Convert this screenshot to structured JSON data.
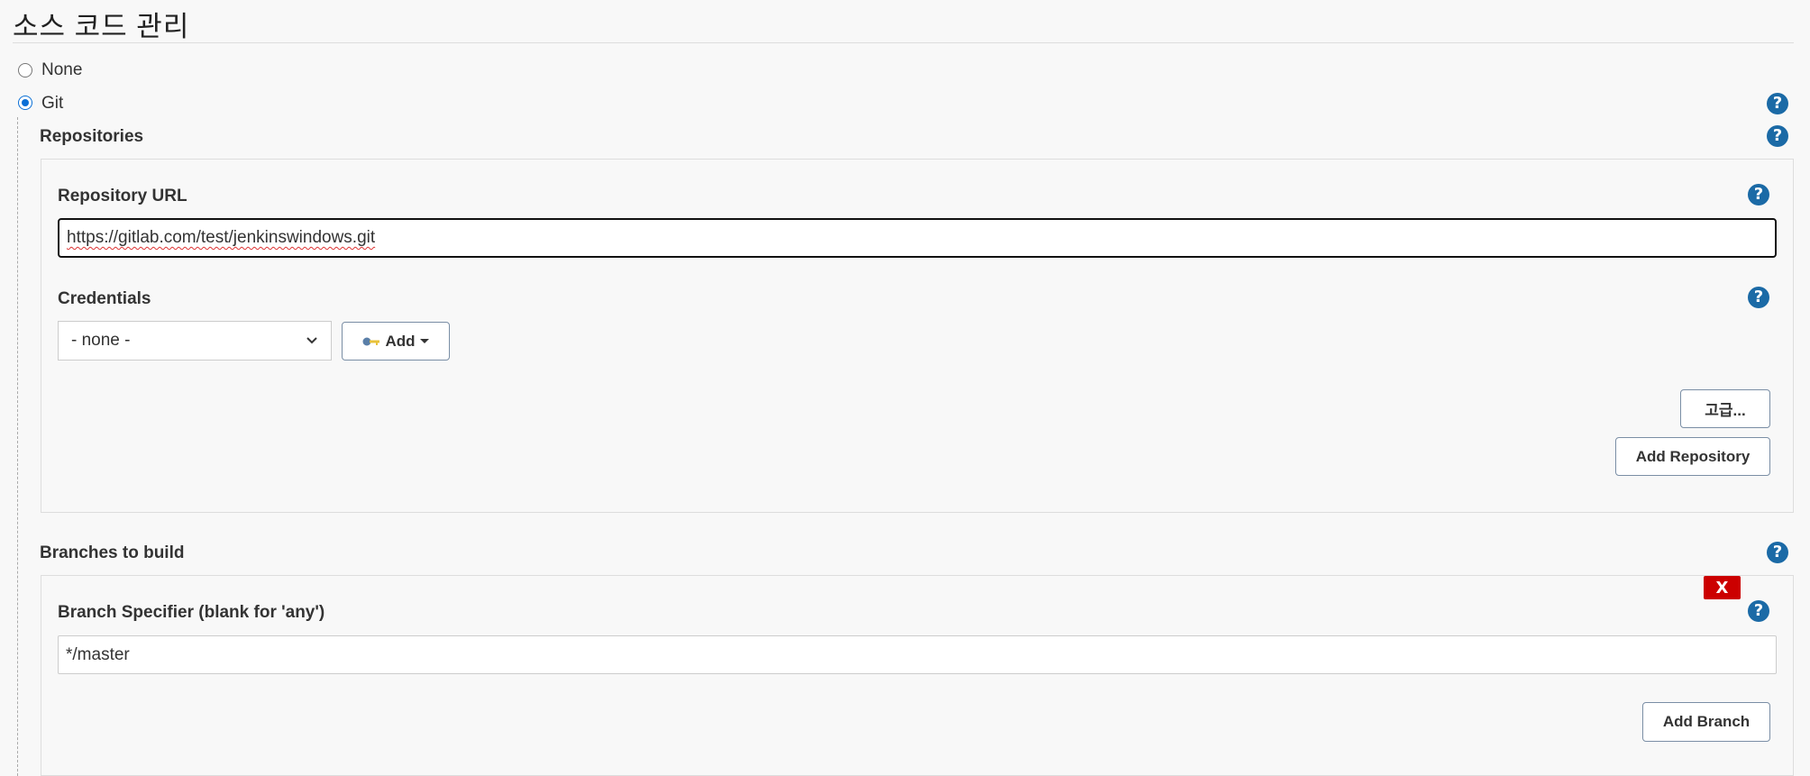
{
  "section_title": "소스 코드 관리",
  "scm": {
    "options": [
      {
        "label": "None",
        "selected": false
      },
      {
        "label": "Git",
        "selected": true
      }
    ]
  },
  "repositories": {
    "label": "Repositories",
    "repository_url_label": "Repository URL",
    "repository_url_value": "https://gitlab.com/test/jenkinswindows.git",
    "credentials_label": "Credentials",
    "credentials_selected": "- none -",
    "add_button": "Add",
    "advanced_button": "고급...",
    "add_repository_button": "Add Repository"
  },
  "branches": {
    "label": "Branches to build",
    "delete_button": "X",
    "specifier_label": "Branch Specifier (blank for 'any')",
    "specifier_value": "*/master",
    "add_branch_button": "Add Branch"
  },
  "help_icon_glyph": "?",
  "colors": {
    "help_icon": "#1b6aa6",
    "radio_selected": "#0a6fd6",
    "delete_button": "#cc0000"
  }
}
